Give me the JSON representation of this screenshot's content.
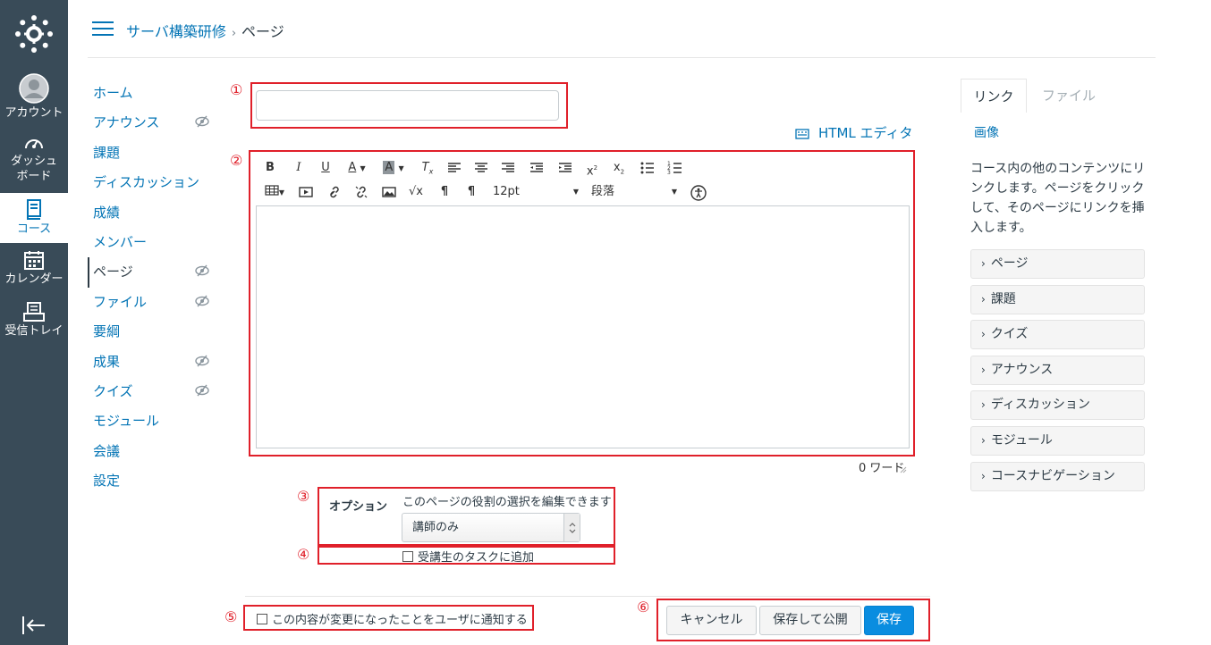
{
  "global_nav": {
    "items": [
      {
        "id": "account",
        "label": "アカウント"
      },
      {
        "id": "dashboard",
        "label": "ダッシュ\nボード"
      },
      {
        "id": "courses",
        "label": "コース"
      },
      {
        "id": "calendar",
        "label": "カレンダー"
      },
      {
        "id": "inbox",
        "label": "受信トレイ"
      }
    ]
  },
  "breadcrumb": {
    "course": "サーバ構築研修",
    "separator": "›",
    "current": "ページ"
  },
  "course_nav": {
    "items": [
      {
        "label": "ホーム"
      },
      {
        "label": "アナウンス"
      },
      {
        "label": "課題"
      },
      {
        "label": "ディスカッション"
      },
      {
        "label": "成績"
      },
      {
        "label": "メンバー"
      },
      {
        "label": "ページ"
      },
      {
        "label": "ファイル"
      },
      {
        "label": "要綱"
      },
      {
        "label": "成果"
      },
      {
        "label": "クイズ"
      },
      {
        "label": "モジュール"
      },
      {
        "label": "会議"
      },
      {
        "label": "設定"
      }
    ]
  },
  "annotations": {
    "n1": "①",
    "n2": "②",
    "n3": "③",
    "n4": "④",
    "n5": "⑤",
    "n6": "⑥",
    "color": "#e0202a"
  },
  "editor": {
    "title_value": "",
    "html_editor_link": "HTML エディタ",
    "font_size": "12pt",
    "paragraph": "段落",
    "word_count": "0 ワード"
  },
  "options": {
    "label": "オプション",
    "description": "このページの役割の選択を編集できます",
    "select_value": "講師のみ",
    "todo_label": "受講生のタスクに追加"
  },
  "footer": {
    "notify_label": "この内容が変更になったことをユーザに通知する",
    "cancel": "キャンセル",
    "save_publish": "保存して公開",
    "save": "保存"
  },
  "sidebar": {
    "tabs": {
      "links": "リンク",
      "files": "ファイル"
    },
    "image_link": "画像",
    "description": "コース内の他のコンテンツにリンクします。ページをクリックして、そのページにリンクを挿入します。",
    "sections": [
      "ページ",
      "課題",
      "クイズ",
      "アナウンス",
      "ディスカッション",
      "モジュール",
      "コースナビゲーション"
    ]
  },
  "colors": {
    "nav_bg": "#394b58",
    "link": "#0374b5",
    "primary": "#0a8de0"
  }
}
